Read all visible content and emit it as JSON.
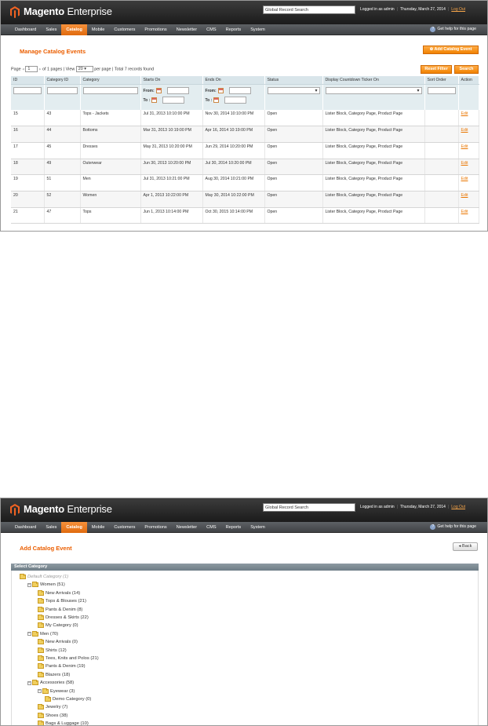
{
  "header": {
    "brand_bold": "Magento",
    "brand_light": "Enterprise",
    "global_search": "Global Record Search",
    "logged_in": "Logged in as admin",
    "date": "Thursday, March 27, 2014",
    "logout": "Log Out"
  },
  "nav": {
    "items": [
      "Dashboard",
      "Sales",
      "Catalog",
      "Mobile",
      "Customers",
      "Promotions",
      "Newsletter",
      "CMS",
      "Reports",
      "System"
    ],
    "active": "Catalog",
    "help": "Get help for this page"
  },
  "screen1": {
    "title": "Manage Catalog Events",
    "add_button": "Add Catalog Event",
    "reset_button": "Reset Filter",
    "search_button": "Search",
    "pager": {
      "page_label": "Page",
      "page_value": "1",
      "of_pages": "of 1 pages",
      "view_label": "View",
      "per_page_value": "20",
      "per_page_label": "per page",
      "total": "Total 7 records found"
    },
    "columns": [
      "ID",
      "Category ID",
      "Category",
      "Starts On",
      "Ends On",
      "Status",
      "Display Countdown Ticker On",
      "Sort Order",
      "Action"
    ],
    "filter_labels": {
      "from": "From:",
      "to": "To :"
    },
    "rows": [
      {
        "id": "15",
        "category_id": "43",
        "category": "Tops - Jackets",
        "starts": "Jul 31, 2013 10:10:00 PM",
        "ends": "Nov 30, 2014 10:10:00 PM",
        "status": "Open",
        "ticker": "Lister Block, Category Page, Product Page",
        "sort": "",
        "action": "Edit"
      },
      {
        "id": "16",
        "category_id": "44",
        "category": "Bottoms",
        "starts": "Mar 31, 2013 10:19:00 PM",
        "ends": "Apr 16, 2014 10:19:00 PM",
        "status": "Open",
        "ticker": "Lister Block, Category Page, Product Page",
        "sort": "",
        "action": "Edit"
      },
      {
        "id": "17",
        "category_id": "45",
        "category": "Dresses",
        "starts": "May 31, 2013 10:20:00 PM",
        "ends": "Jun 29, 2014 10:20:00 PM",
        "status": "Open",
        "ticker": "Lister Block, Category Page, Product Page",
        "sort": "",
        "action": "Edit"
      },
      {
        "id": "18",
        "category_id": "49",
        "category": "Outerwear",
        "starts": "Jun 30, 2013 10:20:00 PM",
        "ends": "Jul 30, 2014 10:20:00 PM",
        "status": "Open",
        "ticker": "Lister Block, Category Page, Product Page",
        "sort": "",
        "action": "Edit"
      },
      {
        "id": "19",
        "category_id": "51",
        "category": "Men",
        "starts": "Jul 31, 2013 10:21:00 PM",
        "ends": "Aug 30, 2014 10:21:00 PM",
        "status": "Open",
        "ticker": "Lister Block, Category Page, Product Page",
        "sort": "",
        "action": "Edit"
      },
      {
        "id": "20",
        "category_id": "52",
        "category": "Women",
        "starts": "Apr 1, 2013 10:22:00 PM",
        "ends": "May 30, 2014 10:22:00 PM",
        "status": "Open",
        "ticker": "Lister Block, Category Page, Product Page",
        "sort": "",
        "action": "Edit"
      },
      {
        "id": "21",
        "category_id": "47",
        "category": "Tops",
        "starts": "Jun 1, 2013 10:14:00 PM",
        "ends": "Oct 30, 2015 10:14:00 PM",
        "status": "Open",
        "ticker": "Lister Block, Category Page, Product Page",
        "sort": "",
        "action": "Edit"
      }
    ]
  },
  "screen2": {
    "title": "Add Catalog Event",
    "back_button": "Back",
    "section": "Select Category",
    "tree": [
      {
        "label": "Default Category (1)",
        "level": 0,
        "root": true,
        "toggle": ""
      },
      {
        "label": "Women (51)",
        "level": 1,
        "toggle": "−"
      },
      {
        "label": "New Arrivals (14)",
        "level": 2,
        "toggle": ""
      },
      {
        "label": "Tops & Blouses (21)",
        "level": 2,
        "toggle": ""
      },
      {
        "label": "Pants & Denim (8)",
        "level": 2,
        "toggle": ""
      },
      {
        "label": "Dresses & Skirts (22)",
        "level": 2,
        "toggle": ""
      },
      {
        "label": "My Category (0)",
        "level": 2,
        "toggle": ""
      },
      {
        "label": "Men (70)",
        "level": 1,
        "toggle": "−"
      },
      {
        "label": "New Arrivals (0)",
        "level": 2,
        "toggle": ""
      },
      {
        "label": "Shirts (12)",
        "level": 2,
        "toggle": ""
      },
      {
        "label": "Tees, Knits and Polos (21)",
        "level": 2,
        "toggle": ""
      },
      {
        "label": "Pants & Denim (19)",
        "level": 2,
        "toggle": ""
      },
      {
        "label": "Blazers (18)",
        "level": 2,
        "toggle": ""
      },
      {
        "label": "Accessories (58)",
        "level": 1,
        "toggle": "−"
      },
      {
        "label": "Eyewear (3)",
        "level": 2,
        "toggle": "−"
      },
      {
        "label": "Demo Category (0)",
        "level": 3,
        "toggle": ""
      },
      {
        "label": "Jewelry (7)",
        "level": 2,
        "toggle": ""
      },
      {
        "label": "Shoes (38)",
        "level": 2,
        "toggle": ""
      },
      {
        "label": "Bags & Luggage (10)",
        "level": 2,
        "toggle": ""
      }
    ]
  },
  "colors": {
    "accent": "#eb5e00",
    "header": "#2a2a2a",
    "grid_header": "#d9e5ea"
  }
}
